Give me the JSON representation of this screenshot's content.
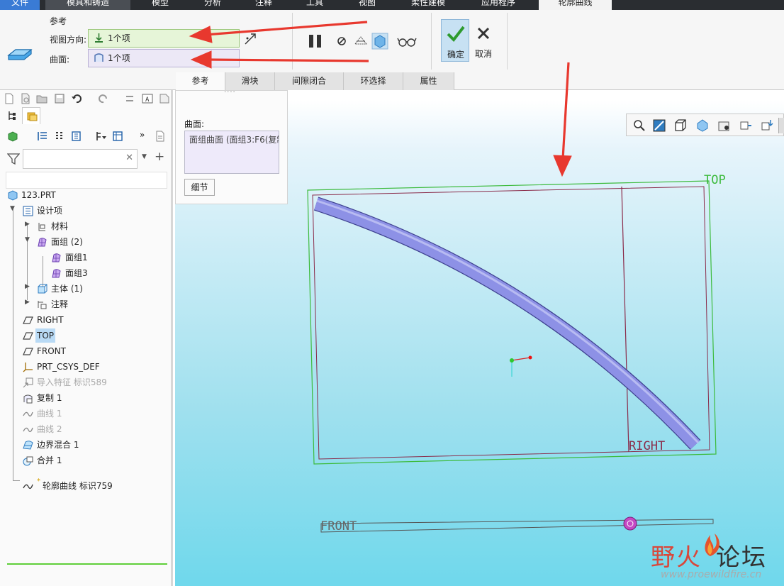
{
  "menubar": {
    "items": [
      {
        "label": "文件",
        "active": false
      },
      {
        "label": "模具和铸造",
        "active": false
      },
      {
        "label": "模型",
        "active": false
      },
      {
        "label": "分析",
        "active": false
      },
      {
        "label": "注释",
        "active": false
      },
      {
        "label": "工具",
        "active": false
      },
      {
        "label": "视图",
        "active": false
      },
      {
        "label": "柔性建模",
        "active": false
      },
      {
        "label": "应用程序",
        "active": false
      },
      {
        "label": "轮廓曲线",
        "active": true
      }
    ]
  },
  "ribbon": {
    "group_title": "参考",
    "view_dir_label": "视图方向:",
    "view_dir_value": "1个项",
    "surface_label": "曲面:",
    "surface_value": "1个项",
    "ok_label": "确定",
    "cancel_label": "取消",
    "tabs": [
      "参考",
      "滑块",
      "间隙闭合",
      "环选择",
      "属性"
    ],
    "selected_tab": "参考"
  },
  "popup": {
    "surface_label": "曲面:",
    "surface_item": "面组曲面 (面组3:F6(复制",
    "details_button": "细节"
  },
  "search": {
    "placeholder": ""
  },
  "tree": {
    "root": "123.PRT",
    "design_items": "设计项",
    "material": "材料",
    "quilts": "面组 (2)",
    "quilt1": "面组1",
    "quilt3": "面组3",
    "bodies": "主体 (1)",
    "annotations": "注释",
    "right": "RIGHT",
    "top": "TOP",
    "front": "FRONT",
    "csys": "PRT_CSYS_DEF",
    "import_feature": "导入特征 标识589",
    "copy1": "复制 1",
    "curve1": "曲线 1",
    "curve2": "曲线 2",
    "boundary_blend": "边界混合 1",
    "merge1": "合并 1",
    "silhouette_curve": "轮廓曲线 标识759",
    "new_marker": "*"
  },
  "graphics": {
    "datum_top": "TOP",
    "datum_right": "RIGHT",
    "datum_front": "FRONT"
  },
  "watermark": {
    "brand_part1": "野火",
    "brand_part2": "论坛",
    "url": "www.proewildfire.cn"
  },
  "colors": {
    "accent_blue": "#3a7bd5",
    "arrow_red": "#e8382e",
    "datum_green": "#3dbb3d",
    "datum_maroon": "#8a2b4a",
    "surface_blue": "#8d91e6"
  }
}
